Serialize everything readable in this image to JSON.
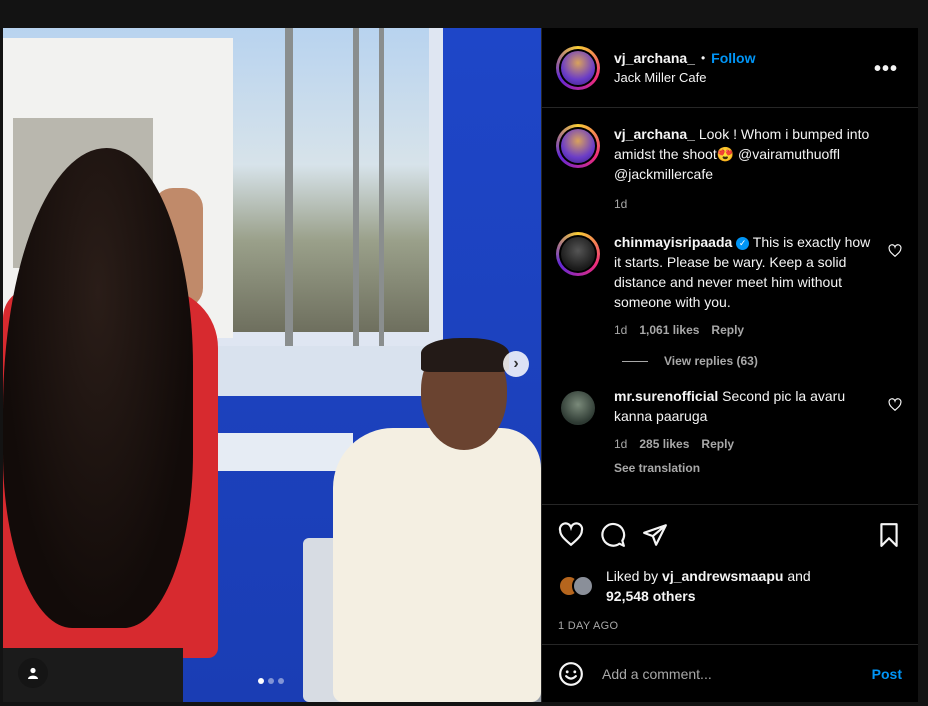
{
  "post": {
    "username": "vj_archana_",
    "separator": "•",
    "follow_label": "Follow",
    "location": "Jack Miller Cafe",
    "more_label": "•••",
    "media": {
      "next_label": "›",
      "carousel_count": 3,
      "carousel_active": 1
    }
  },
  "comments": {
    "caption": {
      "username": "vj_archana_",
      "text": " Look ! Whom i bumped into amidst the shoot😍 @vairamuthuoffl @jackmillercafe",
      "time": "1d"
    },
    "items": [
      {
        "username": "chinmayisripaada",
        "verified_mark": "✓",
        "text": " This is exactly how it starts. Please be wary. Keep a solid distance and never meet him without someone with you.",
        "time": "1d",
        "likes": "1,061 likes",
        "reply_label": "Reply",
        "view_replies": "View replies (63)"
      },
      {
        "username": "mr.surenofficial",
        "text": " Second pic la avaru kanna paaruga",
        "time": "1d",
        "likes": "285 likes",
        "reply_label": "Reply",
        "see_translation": "See translation"
      }
    ]
  },
  "likes": {
    "prefix": "Liked by ",
    "user": "vj_andrewsmaapu",
    "middle": " and",
    "count": "92,548 others"
  },
  "time_ago": "1 DAY AGO",
  "comment_box": {
    "placeholder": "Add a comment...",
    "post_label": "Post"
  },
  "colors": {
    "accent": "#0095f6",
    "background": "#000000",
    "muted_text": "#a8a8a8"
  },
  "icons": [
    "heart-icon",
    "comment-icon",
    "share-icon",
    "bookmark-icon",
    "emoji-icon",
    "user-tag-icon",
    "more-icon",
    "chevron-right-icon"
  ]
}
